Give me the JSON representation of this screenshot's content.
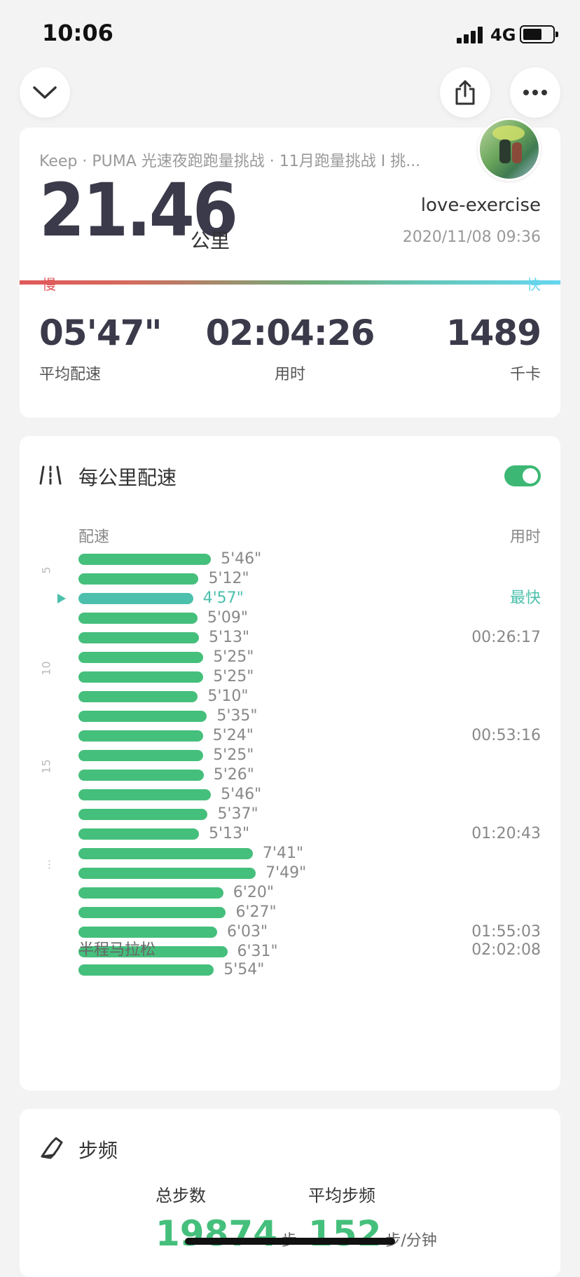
{
  "status_bar": {
    "time": "10:06",
    "network": "4G"
  },
  "summary": {
    "source": "Keep · PUMA 光速夜跑跑量挑战 · 11月跑量挑战 I 挑...",
    "distance": "21.46",
    "distance_unit": "公里",
    "username": "love-exercise",
    "datetime": "2020/11/08 09:36",
    "slow_label": "慢",
    "fast_label": "快",
    "stats": {
      "avg_pace": {
        "value": "05'47\"",
        "label": "平均配速"
      },
      "duration": {
        "value": "02:04:26",
        "label": "用时"
      },
      "calories": {
        "value": "1489",
        "label": "千卡"
      }
    },
    "colors": {
      "slow": "#e0595a",
      "fast": "#66d6ef"
    }
  },
  "pace_section": {
    "title": "每公里配速",
    "toggle_on": true,
    "col_pace": "配速",
    "col_time": "用时",
    "fastest_label": "最快",
    "km_markers": [
      "5",
      "10",
      "15",
      "..."
    ],
    "rows": [
      {
        "pace": "5'46\"",
        "time": ""
      },
      {
        "pace": "5'12\"",
        "time": ""
      },
      {
        "pace": "4'57\"",
        "time": "最快",
        "fastest": true
      },
      {
        "pace": "5'09\"",
        "time": ""
      },
      {
        "pace": "5'13\"",
        "time": "00:26:17"
      },
      {
        "pace": "5'25\"",
        "time": ""
      },
      {
        "pace": "5'25\"",
        "time": ""
      },
      {
        "pace": "5'10\"",
        "time": ""
      },
      {
        "pace": "5'35\"",
        "time": ""
      },
      {
        "pace": "5'24\"",
        "time": "00:53:16"
      },
      {
        "pace": "5'25\"",
        "time": ""
      },
      {
        "pace": "5'26\"",
        "time": ""
      },
      {
        "pace": "5'46\"",
        "time": ""
      },
      {
        "pace": "5'37\"",
        "time": ""
      },
      {
        "pace": "5'13\"",
        "time": "01:20:43"
      },
      {
        "pace": "7'41\"",
        "time": ""
      },
      {
        "pace": "7'49\"",
        "time": ""
      },
      {
        "pace": "6'20\"",
        "time": ""
      },
      {
        "pace": "6'27\"",
        "time": ""
      },
      {
        "pace": "6'03\"",
        "time": "01:55:03"
      },
      {
        "pace": "6'31\"",
        "time": ""
      }
    ],
    "half_marathon": {
      "label": "半程马拉松",
      "time": "02:02:08"
    },
    "last_row": {
      "pace": "5'54\""
    },
    "bar_color": "#45bf7c",
    "fastest_color": "#4cc0ac"
  },
  "cadence": {
    "title": "步频",
    "total_steps": {
      "label": "总步数",
      "value": "19874",
      "unit": "步"
    },
    "avg_cadence": {
      "label": "平均步频",
      "value": "152",
      "unit": "步/分钟"
    }
  }
}
